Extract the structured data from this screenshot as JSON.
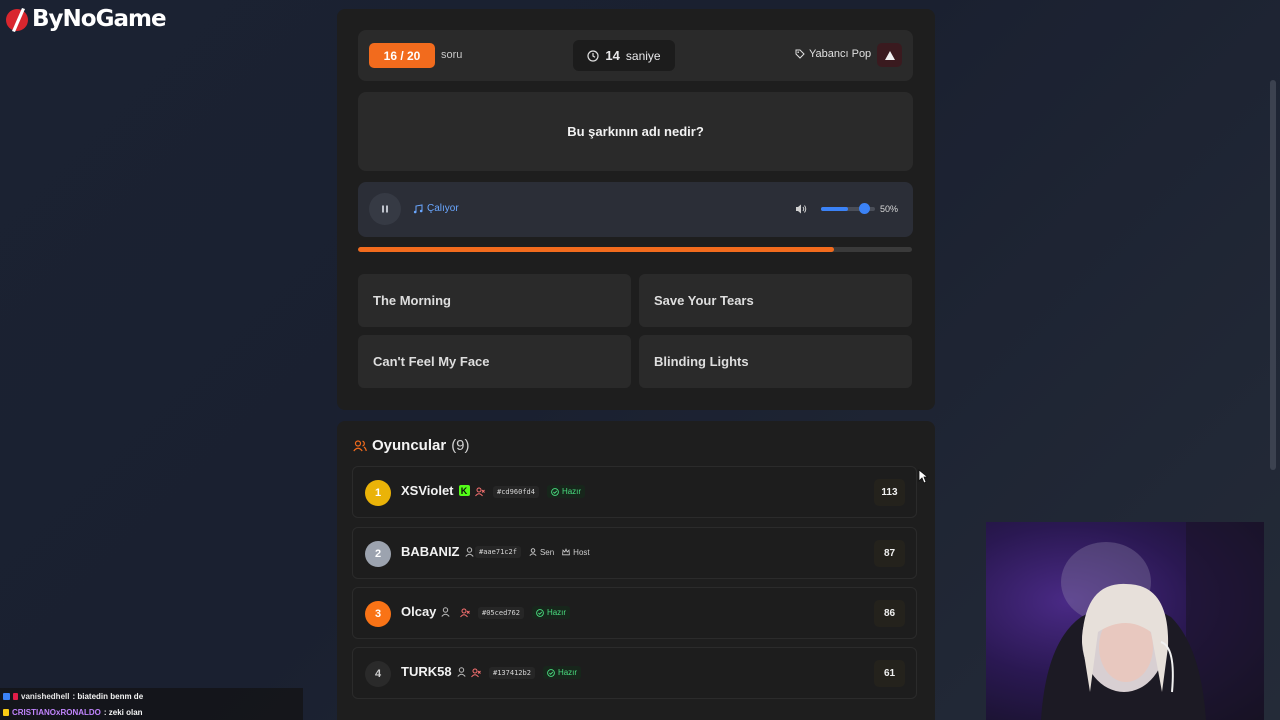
{
  "brand": {
    "name": "ByNoGame",
    "accent": "#f26b1d"
  },
  "quiz": {
    "question_badge": "16 / 20",
    "question_label": "soru",
    "timer_value": "14",
    "timer_unit": "saniye",
    "genre": "Yabancı Pop",
    "question_text": "Bu şarkının adı nedir?"
  },
  "audio": {
    "status": "Çalıyor",
    "volume_text": "50%",
    "volume_level": 0.5,
    "song_progress": 0.86
  },
  "answers": [
    {
      "label": "The Morning"
    },
    {
      "label": "Save Your Tears"
    },
    {
      "label": "Can't Feel My Face"
    },
    {
      "label": "Blinding Lights"
    }
  ],
  "players_section": {
    "title": "Oyuncular",
    "count": "(9)"
  },
  "players": [
    {
      "rank": "1",
      "name": "XSViolet",
      "hash": "#cd960fd4",
      "status": "Hazır",
      "score": "113",
      "rank_color": "#eab308"
    },
    {
      "rank": "2",
      "name": "BABANIZ",
      "hash": "#aae71c2f",
      "you": "Sen",
      "host": "Host",
      "score": "87",
      "rank_color": "#9ca3af"
    },
    {
      "rank": "3",
      "name": "Olcay",
      "hash": "#05ced762",
      "status": "Hazır",
      "score": "86",
      "rank_color": "#f97316"
    },
    {
      "rank": "4",
      "name": "TURK58",
      "hash": "#137412b2",
      "status": "Hazır",
      "score": "61",
      "rank_color": "#2a2a2a"
    }
  ],
  "chat": [
    {
      "user": "vanishedhell",
      "message": ": biatedin benm de",
      "user_color": "#e5e5e5"
    },
    {
      "user": "CRISTIANOxRONALDO",
      "message": ": zeki olan",
      "user_color": "#c084fc"
    }
  ]
}
